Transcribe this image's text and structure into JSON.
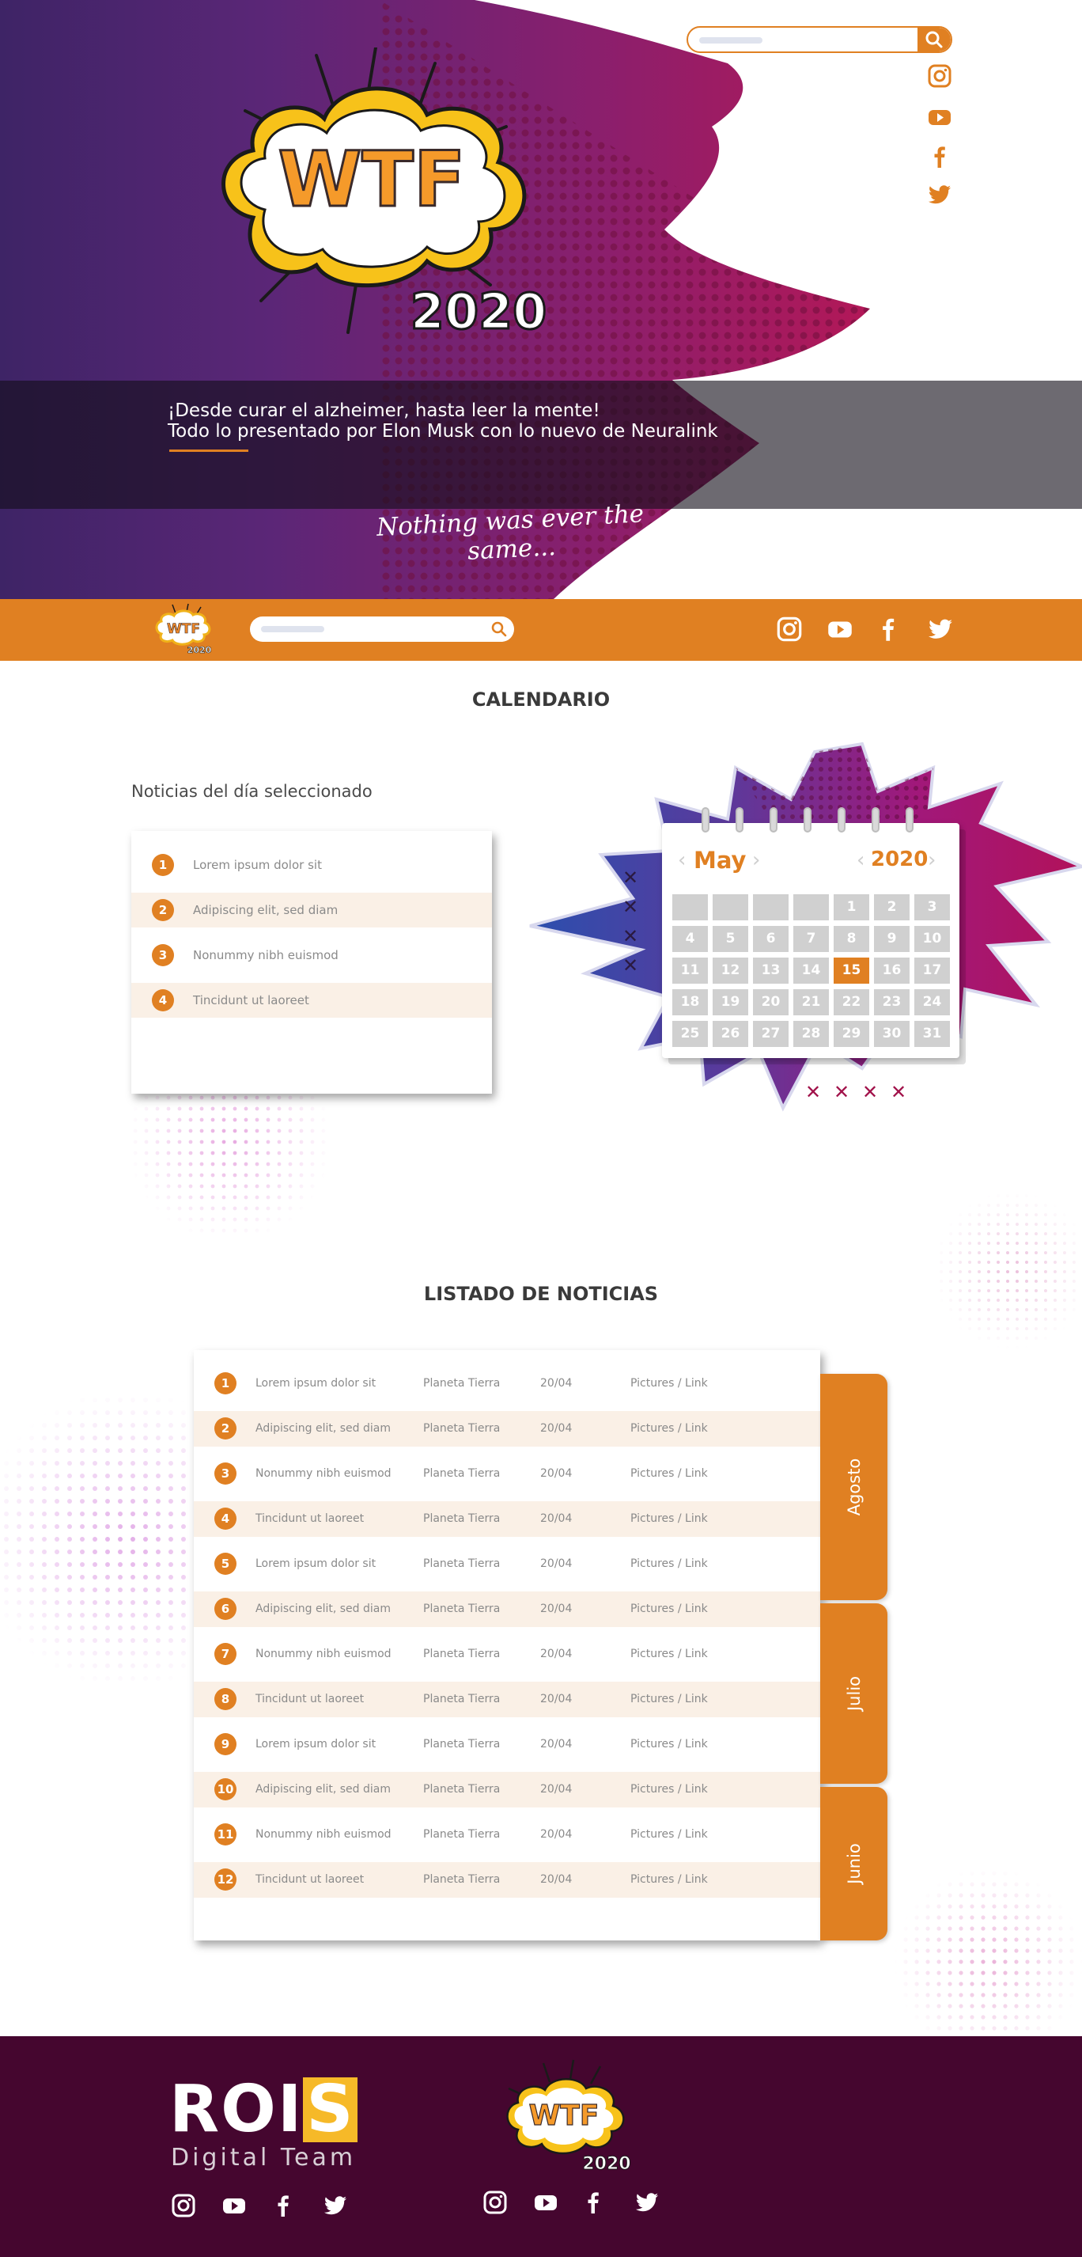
{
  "hero": {
    "logo_text": "WTF",
    "logo_year": "2020",
    "headline_line1": "¡Desde curar el alzheimer, hasta leer la mente!",
    "headline_line2": "Todo lo presentado por Elon Musk con lo nuevo de Neuralink",
    "tagline": "Nothing was ever the same...",
    "social": [
      "instagram-icon",
      "youtube-icon",
      "facebook-icon",
      "twitter-icon"
    ]
  },
  "nav": {
    "logo_text": "WTF",
    "logo_year": "2020",
    "social": [
      "instagram-icon",
      "youtube-icon",
      "facebook-icon",
      "twitter-icon"
    ]
  },
  "calendar_section": {
    "title": "CALENDARIO",
    "news_subtitle": "Noticias del día seleccionado",
    "news_items": [
      {
        "n": "1",
        "text": "Lorem ipsum dolor sit"
      },
      {
        "n": "2",
        "text": "Adipiscing elit, sed diam"
      },
      {
        "n": "3",
        "text": "Nonummy nibh euismod"
      },
      {
        "n": "4",
        "text": "Tincidunt ut laoreet"
      }
    ],
    "calendar": {
      "month": "May",
      "year": "2020",
      "days": [
        "",
        "",
        "",
        "",
        "1",
        "2",
        "3",
        "4",
        "5",
        "6",
        "7",
        "8",
        "9",
        "10",
        "11",
        "12",
        "13",
        "14",
        "15",
        "16",
        "17",
        "18",
        "19",
        "20",
        "21",
        "22",
        "23",
        "24",
        "25",
        "26",
        "27",
        "28",
        "29",
        "30",
        "31"
      ],
      "selected_day": "15"
    }
  },
  "list_section": {
    "title": "LISTADO DE NOTICIAS",
    "rows": [
      {
        "n": "1",
        "title": "Lorem ipsum dolor sit",
        "place": "Planeta Tierra",
        "date": "20/04",
        "media": "Pictures / Link"
      },
      {
        "n": "2",
        "title": "Adipiscing elit, sed diam",
        "place": "Planeta Tierra",
        "date": "20/04",
        "media": "Pictures / Link"
      },
      {
        "n": "3",
        "title": "Nonummy nibh euismod",
        "place": "Planeta Tierra",
        "date": "20/04",
        "media": "Pictures / Link"
      },
      {
        "n": "4",
        "title": "Tincidunt ut laoreet",
        "place": "Planeta Tierra",
        "date": "20/04",
        "media": "Pictures / Link"
      },
      {
        "n": "5",
        "title": "Lorem ipsum dolor sit",
        "place": "Planeta Tierra",
        "date": "20/04",
        "media": "Pictures / Link"
      },
      {
        "n": "6",
        "title": "Adipiscing elit, sed diam",
        "place": "Planeta Tierra",
        "date": "20/04",
        "media": "Pictures / Link"
      },
      {
        "n": "7",
        "title": "Nonummy nibh euismod",
        "place": "Planeta Tierra",
        "date": "20/04",
        "media": "Pictures / Link"
      },
      {
        "n": "8",
        "title": "Tincidunt ut laoreet",
        "place": "Planeta Tierra",
        "date": "20/04",
        "media": "Pictures / Link"
      },
      {
        "n": "9",
        "title": "Lorem ipsum dolor sit",
        "place": "Planeta Tierra",
        "date": "20/04",
        "media": "Pictures / Link"
      },
      {
        "n": "10",
        "title": "Adipiscing elit, sed diam",
        "place": "Planeta Tierra",
        "date": "20/04",
        "media": "Pictures / Link"
      },
      {
        "n": "11",
        "title": "Nonummy nibh euismod",
        "place": "Planeta Tierra",
        "date": "20/04",
        "media": "Pictures / Link"
      },
      {
        "n": "12",
        "title": "Tincidunt ut laoreet",
        "place": "Planeta Tierra",
        "date": "20/04",
        "media": "Pictures / Link"
      }
    ],
    "month_tabs": [
      "Agosto",
      "Julio",
      "Junio"
    ]
  },
  "footer": {
    "brand_main": "ROI",
    "brand_s": "S",
    "brand_sub": "Digital Team",
    "logo_text": "WTF",
    "logo_year": "2020"
  },
  "colors": {
    "accent": "#e08022",
    "footer_bg": "#45062f",
    "hero_magenta": "#b21858",
    "hero_purple": "#3e2466"
  }
}
